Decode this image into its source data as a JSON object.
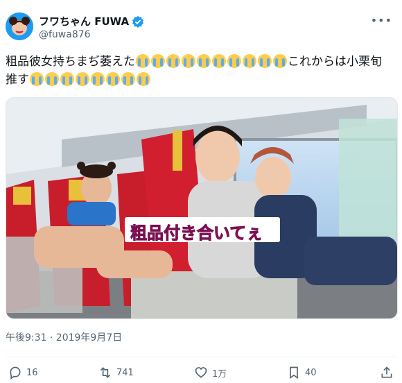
{
  "author": {
    "display_name": "フワちゃん FUWA",
    "handle": "@fuwa876",
    "verified": true,
    "avatar_icon": "avatar"
  },
  "tweet": {
    "text_line1_prefix": "粗品彼女持ちまぢ萎えた",
    "text_line1_suffix": "これからは小栗旬",
    "text_line2_prefix": "推す",
    "emoji": "loudly-crying-face"
  },
  "media": {
    "caption": "粗品付き合いてぇ",
    "caption_color": "#ff2e9a"
  },
  "meta": {
    "timestamp": "午後9:31 · 2019年9月7日"
  },
  "actions": {
    "replies": "16",
    "retweets": "741",
    "likes": "1万",
    "bookmarks": "40"
  },
  "colors": {
    "accent": "#1d9bf0",
    "secondary_text": "#536471"
  }
}
